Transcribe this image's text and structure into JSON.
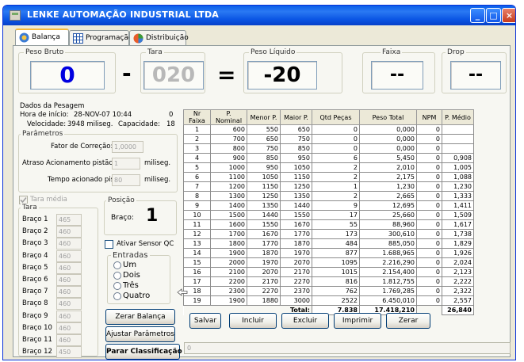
{
  "window": {
    "title": "LENKE AUTOMAÇÃO INDUSTRIAL LTDA"
  },
  "tabs": [
    {
      "label": "Balança",
      "icon": "scale-icon"
    },
    {
      "label": "Programação",
      "icon": "grid-icon"
    },
    {
      "label": "Distribuição",
      "icon": "distribution-icon"
    }
  ],
  "weights": {
    "bruto_label": "Peso Bruto",
    "bruto_value": "0",
    "minus": "-",
    "tara_label": "Tara",
    "tara_value": "020",
    "equals": "=",
    "liquido_label": "Peso Líquido",
    "liquido_value": "-20",
    "faixa_label": "Faixa",
    "faixa_value": "--",
    "drop_label": "Drop",
    "drop_value": "--"
  },
  "dados": {
    "title": "Dados da Pesagem",
    "hora_label": "Hora de início:",
    "hora_value": "28-NOV-07 10:44",
    "hora_count": "0",
    "velocidade_label": "Velocidade:",
    "velocidade_value": "3948 miliseg.",
    "capacidade_label": "Capacidade:",
    "capacidade_value": "18"
  },
  "parametros": {
    "title": "Parâmetros",
    "fator_label": "Fator de Correção:",
    "fator_value": "1,0000",
    "atraso_label": "Atraso Acionamento pistão:",
    "atraso_value": "1",
    "atraso_unit": "miliseg.",
    "tempo_label": "Tempo acionado pistão:",
    "tempo_value": "80",
    "tempo_unit": "miliseg."
  },
  "tara": {
    "media_label": "Tara média",
    "title": "Tara",
    "bracos": [
      {
        "label": "Braço 1",
        "value": "465"
      },
      {
        "label": "Braço 2",
        "value": "460"
      },
      {
        "label": "Braço 3",
        "value": "460"
      },
      {
        "label": "Braço 4",
        "value": "460"
      },
      {
        "label": "Braço 5",
        "value": "460"
      },
      {
        "label": "Braço 6",
        "value": "460"
      },
      {
        "label": "Braço 7",
        "value": "460"
      },
      {
        "label": "Braço 8",
        "value": "460"
      },
      {
        "label": "Braço 9",
        "value": "460"
      },
      {
        "label": "Braço 10",
        "value": "460"
      },
      {
        "label": "Braço 11",
        "value": "460"
      },
      {
        "label": "Braço 12",
        "value": "450"
      }
    ]
  },
  "posicao": {
    "title": "Posição",
    "braco_label": "Braço:",
    "braco_value": "1"
  },
  "sensor": {
    "label": "Ativar Sensor QC"
  },
  "entradas": {
    "title": "Entradas",
    "options": [
      "Um",
      "Dois",
      "Três",
      "Quatro"
    ]
  },
  "buttons": {
    "zerar_balanca": "Zerar Balança",
    "ajustar": "Ajustar Parâmetros",
    "parar": "Parar Classificação",
    "salvar": "Salvar",
    "incluir": "Incluir",
    "excluir": "Excluir",
    "imprimir": "Imprimir",
    "zerar": "Zerar"
  },
  "table": {
    "headers": [
      "Nr Faixa",
      "P. Nominal",
      "Menor P.",
      "Maior P.",
      "Qtd Peças",
      "Peso Total",
      "NPM",
      "P. Médio"
    ],
    "rows": [
      [
        "1",
        "600",
        "550",
        "650",
        "0",
        "0,000",
        "0",
        ""
      ],
      [
        "2",
        "700",
        "650",
        "750",
        "0",
        "0,000",
        "0",
        ""
      ],
      [
        "3",
        "800",
        "750",
        "850",
        "0",
        "0,000",
        "0",
        ""
      ],
      [
        "4",
        "900",
        "850",
        "950",
        "6",
        "5,450",
        "0",
        "0,908"
      ],
      [
        "5",
        "1000",
        "950",
        "1050",
        "2",
        "2,010",
        "0",
        "1,005"
      ],
      [
        "6",
        "1100",
        "1050",
        "1150",
        "2",
        "2,175",
        "0",
        "1,088"
      ],
      [
        "7",
        "1200",
        "1150",
        "1250",
        "1",
        "1,230",
        "0",
        "1,230"
      ],
      [
        "8",
        "1300",
        "1250",
        "1350",
        "2",
        "2,665",
        "0",
        "1,333"
      ],
      [
        "9",
        "1400",
        "1350",
        "1440",
        "9",
        "12,695",
        "0",
        "1,411"
      ],
      [
        "10",
        "1500",
        "1440",
        "1550",
        "17",
        "25,660",
        "0",
        "1,509"
      ],
      [
        "11",
        "1600",
        "1550",
        "1670",
        "55",
        "88,960",
        "0",
        "1,617"
      ],
      [
        "12",
        "1700",
        "1670",
        "1770",
        "173",
        "300,610",
        "0",
        "1,738"
      ],
      [
        "13",
        "1800",
        "1770",
        "1870",
        "484",
        "885,050",
        "0",
        "1,829"
      ],
      [
        "14",
        "1900",
        "1870",
        "1970",
        "877",
        "1.688,965",
        "0",
        "1,926"
      ],
      [
        "15",
        "2000",
        "1970",
        "2070",
        "1095",
        "2.216,290",
        "0",
        "2,024"
      ],
      [
        "16",
        "2100",
        "2070",
        "2170",
        "1015",
        "2.154,400",
        "0",
        "2,123"
      ],
      [
        "17",
        "2200",
        "2170",
        "2270",
        "816",
        "1.812,755",
        "0",
        "2,222"
      ],
      [
        "18",
        "2300",
        "2270",
        "2370",
        "762",
        "1.769,285",
        "0",
        "2,322"
      ],
      [
        "19",
        "1900",
        "1880",
        "3000",
        "2522",
        "6.450,010",
        "0",
        "2,557"
      ]
    ],
    "total_label": "Total:",
    "total_qtd": "7.838",
    "total_peso": "17.418,210",
    "total_medio": "26,840"
  },
  "status": {
    "text": "0"
  }
}
